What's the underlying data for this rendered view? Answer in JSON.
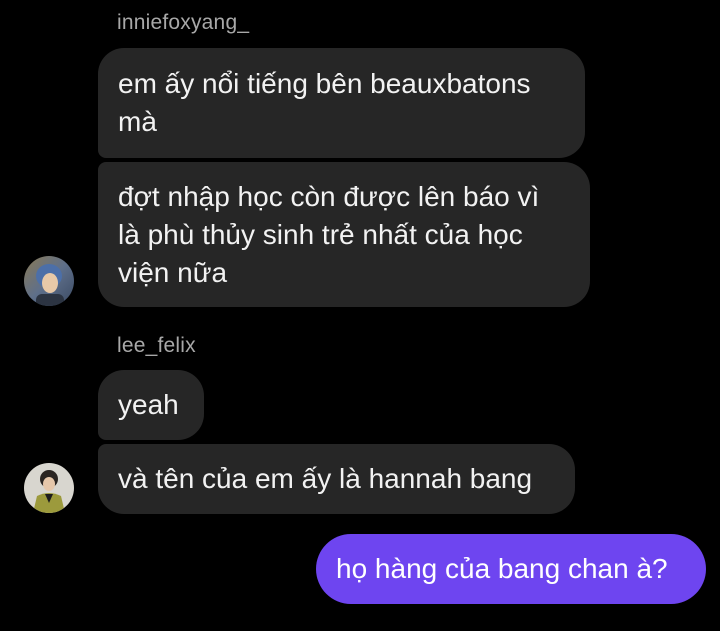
{
  "messages": [
    {
      "sender": "inniefoxyang_",
      "bubbles": [
        "em ấy nổi tiếng bên beauxbatons\nmà",
        "đợt nhập học còn được lên báo vì\nlà phù thủy sinh trẻ nhất của học\nviện nữa"
      ]
    },
    {
      "sender": "lee_felix",
      "bubbles": [
        "yeah",
        "và tên của em ấy là hannah bang"
      ]
    },
    {
      "sender": "me",
      "bubbles": [
        "họ hàng của bang chan à?"
      ]
    }
  ],
  "colors": {
    "background": "#000000",
    "incoming_bubble": "#262626",
    "outgoing_bubble": "#6e45f0",
    "username_text": "#a8a8a8"
  },
  "icons": [
    "avatar-inniefoxyang",
    "avatar-lee-felix"
  ]
}
